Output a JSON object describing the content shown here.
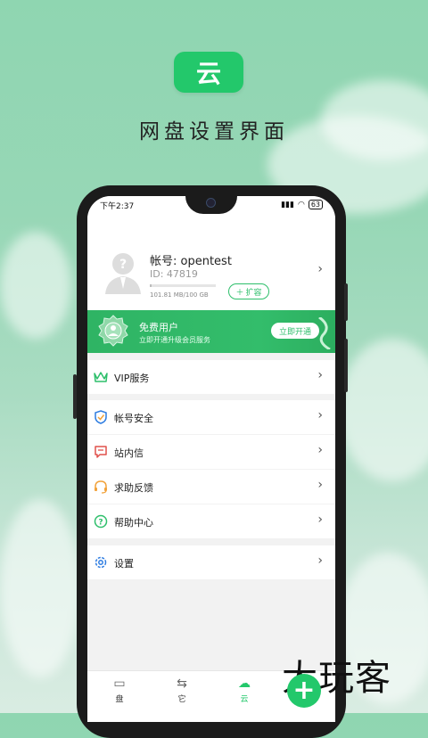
{
  "promo": {
    "logo_text": "云",
    "title": "网盘设置界面"
  },
  "status_bar": {
    "time": "下午2:37",
    "battery": "63"
  },
  "profile": {
    "account": "帐号: opentest",
    "id": "ID: 47819",
    "storage_text": "101.81 MB/100 GB",
    "storage_fraction": 0.02,
    "expand_label": "扩容"
  },
  "vip": {
    "title": "免费用户",
    "subtitle": "立即开通升级会员服务",
    "button": "立即开通"
  },
  "menu": [
    {
      "label": "VIP服务",
      "icon": "crown-icon"
    },
    {
      "label": "帐号安全",
      "icon": "shield-icon"
    },
    {
      "label": "站内信",
      "icon": "message-icon"
    },
    {
      "label": "求助反馈",
      "icon": "headset-icon"
    },
    {
      "label": "帮助中心",
      "icon": "help-icon"
    },
    {
      "label": "设置",
      "icon": "gear-icon"
    }
  ],
  "bottom_nav": [
    {
      "label": "盘",
      "icon": "disk-icon"
    },
    {
      "label": "它",
      "icon": "transfer-icon"
    },
    {
      "label": "云",
      "icon": "cloud-icon",
      "active": true
    }
  ],
  "watermark": "大玩客",
  "colors": {
    "accent": "#23c86b",
    "background": "#95d6b4"
  }
}
